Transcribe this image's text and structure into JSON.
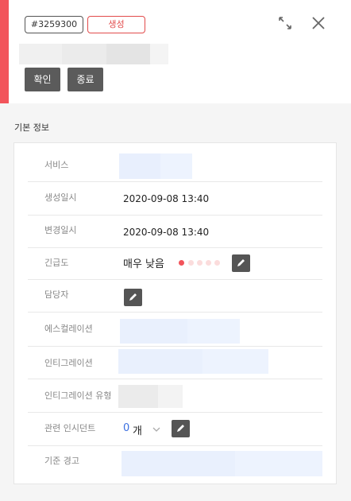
{
  "header": {
    "id_badge": "#3259300",
    "status_badge": "생성",
    "confirm_label": "확인",
    "close_label": "종료",
    "accent_color": "#f2545b"
  },
  "section_title": "기본 정보",
  "fields": {
    "service": {
      "label": "서비스"
    },
    "created": {
      "label": "생성일시",
      "value": "2020-09-08 13:40"
    },
    "modified": {
      "label": "변경일시",
      "value": "2020-09-08 13:40"
    },
    "urgency": {
      "label": "긴급도",
      "value": "매우 낮음",
      "level": 1,
      "max": 5
    },
    "assignee": {
      "label": "담당자"
    },
    "escalation": {
      "label": "에스컬레이션"
    },
    "integration": {
      "label": "인티그레이션"
    },
    "integration_type": {
      "label": "인티그레이션 유형"
    },
    "related": {
      "label": "관련 인시던트",
      "count": "0",
      "unit": "개"
    },
    "criteria": {
      "label": "기준 경고"
    }
  },
  "icons": [
    "expand-icon",
    "close-icon",
    "pencil-icon",
    "chevron-down-icon"
  ]
}
